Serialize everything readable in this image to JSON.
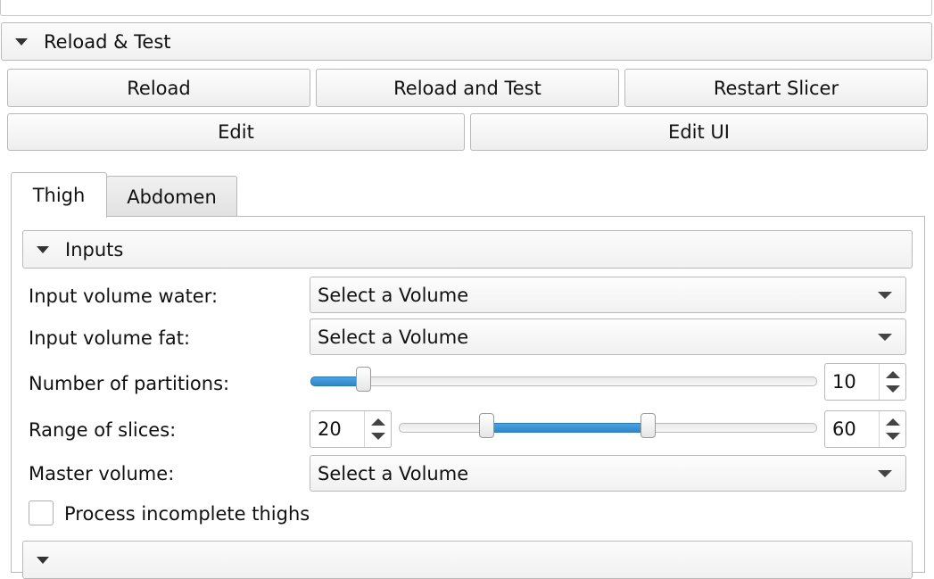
{
  "reload_section": {
    "title": "Reload & Test",
    "buttons": {
      "reload": "Reload",
      "reload_and_test": "Reload and Test",
      "restart": "Restart Slicer",
      "edit": "Edit",
      "edit_ui": "Edit UI"
    }
  },
  "tabs": [
    {
      "label": "Thigh",
      "active": true
    },
    {
      "label": "Abdomen",
      "active": false
    }
  ],
  "inputs_section": {
    "title": "Inputs",
    "input_water": {
      "label": "Input volume water:",
      "value": "Select a Volume"
    },
    "input_fat": {
      "label": "Input volume fat:",
      "value": "Select a Volume"
    },
    "partitions": {
      "label": "Number of partitions:",
      "value": "10"
    },
    "slices": {
      "label": "Range of slices:",
      "min": "20",
      "max": "60"
    },
    "master": {
      "label": "Master volume:",
      "value": "Select a Volume"
    },
    "incomplete": {
      "label": "Process incomplete thighs",
      "checked": false
    }
  },
  "colors": {
    "slider_fill": "#2f86c9",
    "border": "#b9b9b9"
  }
}
